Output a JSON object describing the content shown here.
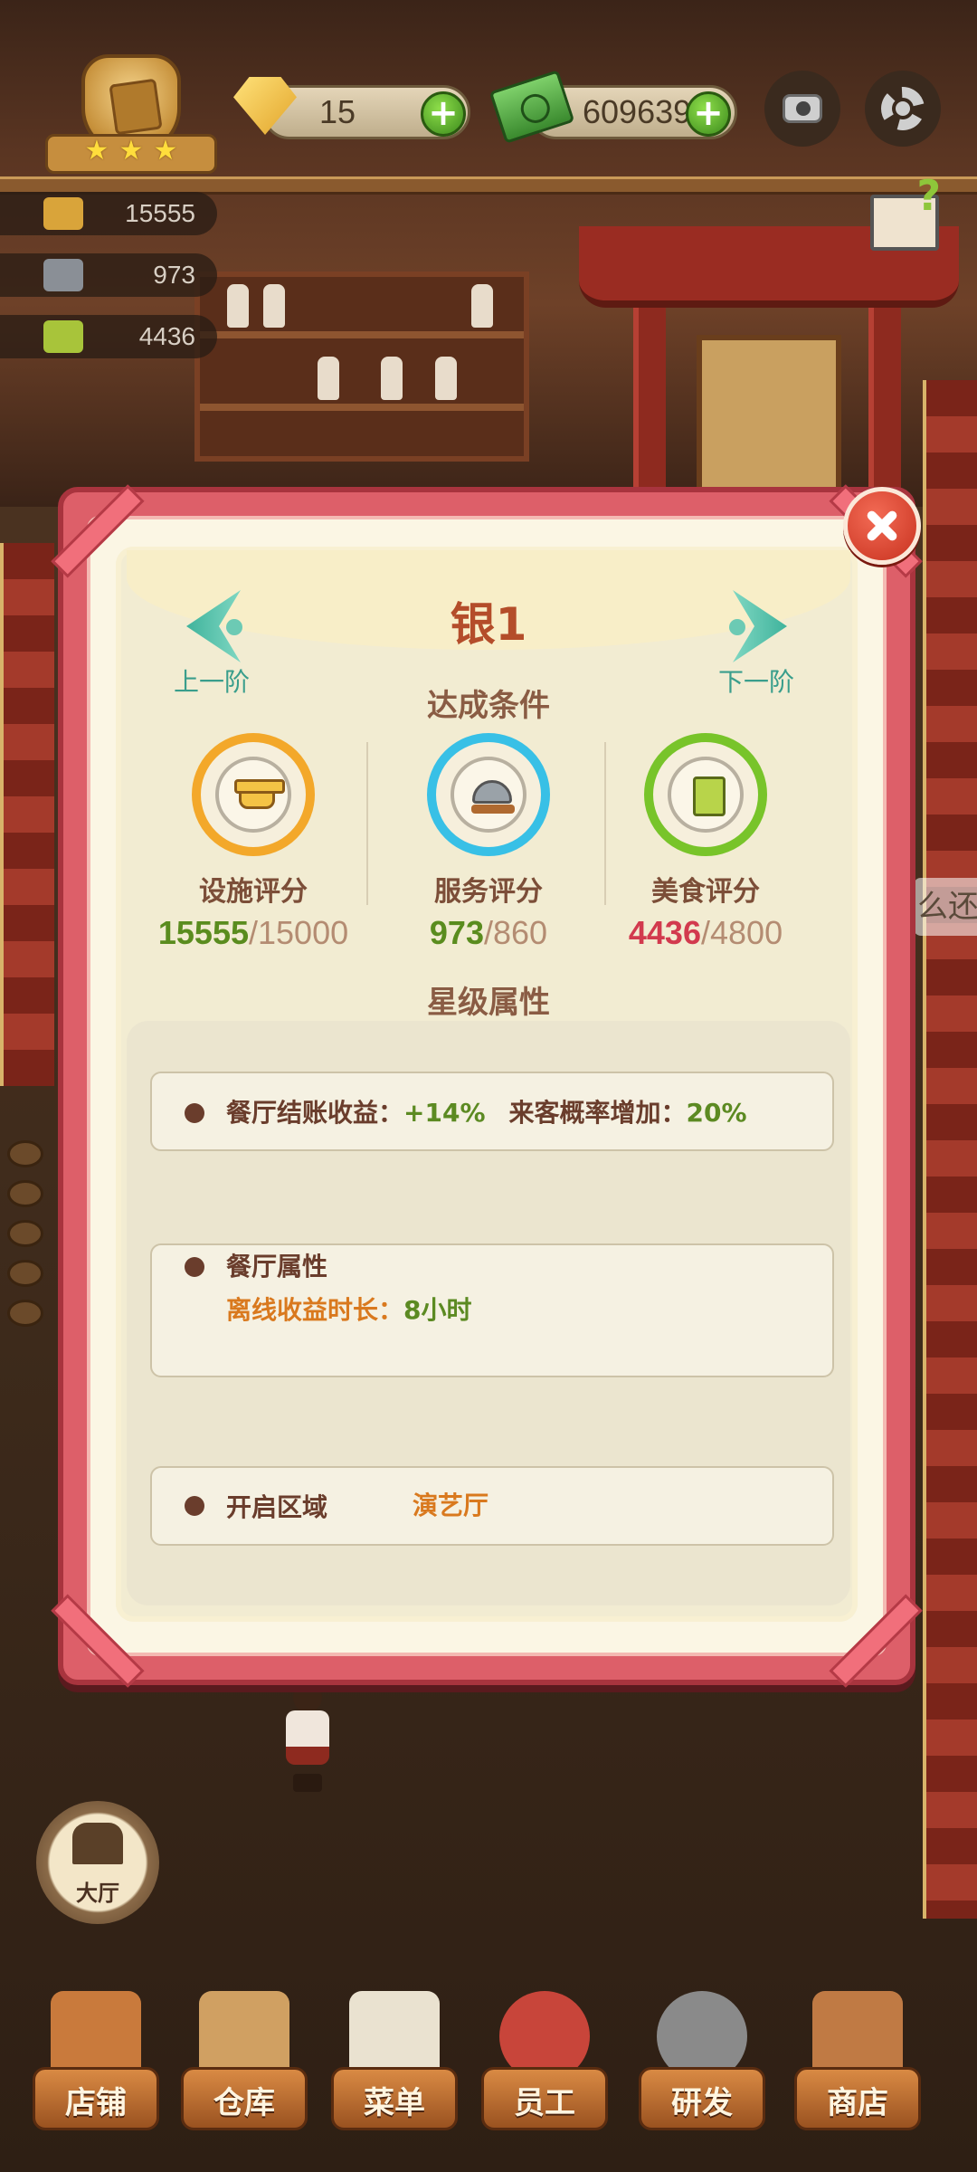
{
  "hud": {
    "gems": "15",
    "cash": "609639",
    "stats": [
      "15555",
      "973",
      "4436"
    ]
  },
  "edge_text": "么还",
  "dialog": {
    "title": "银1",
    "prev_label": "上一阶",
    "next_label": "下一阶",
    "conditions_title": "达成条件",
    "requirements": [
      {
        "label": "设施评分",
        "current": "15555",
        "target": "15000",
        "ring_color": "#f3a82a",
        "current_color": "#5a8c1e",
        "icon": "pot-icon"
      },
      {
        "label": "服务评分",
        "current": "973",
        "target": "860",
        "ring_color": "#38c0e6",
        "current_color": "#5a8c1e",
        "icon": "cloche-icon"
      },
      {
        "label": "美食评分",
        "current": "4436",
        "target": "4800",
        "ring_color": "#78c42a",
        "current_color": "#d23a4e",
        "icon": "recipe-book-icon"
      }
    ],
    "attributes_title": "星级属性",
    "cards": {
      "income": {
        "label1": "餐厅结账收益：",
        "value1": "+14%",
        "label2": "来客概率增加：",
        "value2": "20%"
      },
      "restaurant": {
        "title": "餐厅属性",
        "offline_label": "离线收益时长：",
        "offline_value": "8小时"
      },
      "unlock": {
        "label": "开启区域",
        "value": "演艺厅"
      }
    }
  },
  "hall_button": "大厅",
  "nav": [
    {
      "label": "店铺"
    },
    {
      "label": "仓库"
    },
    {
      "label": "菜单"
    },
    {
      "label": "员工"
    },
    {
      "label": "研发"
    },
    {
      "label": "商店"
    }
  ],
  "colors": {
    "frame": "#dd5f69",
    "title": "#b44d2a",
    "teal_arrow": "#3fb39c",
    "green_value": "#5c8a22",
    "orange_value": "#d9791e"
  }
}
